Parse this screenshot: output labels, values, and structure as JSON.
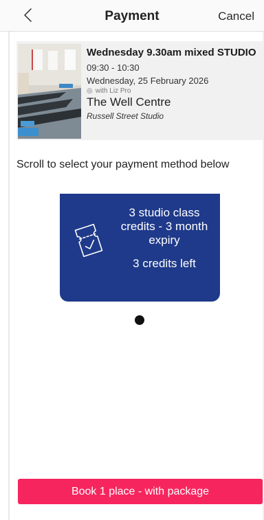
{
  "header": {
    "title": "Payment",
    "cancel_label": "Cancel",
    "back_icon": "chevron-left-icon"
  },
  "class": {
    "title": "Wednesday 9.30am mixed STUDIO",
    "time": "09:30 - 10:30",
    "date": "Wednesday, 25 February 2026",
    "instructor": "with Liz Pro",
    "venue": "The Well Centre",
    "room": "Russell Street Studio"
  },
  "instruction": "Scroll to select your payment method below",
  "payment_methods": [
    {
      "name": "3 studio class credits - 3 month expiry",
      "credits": "3 credits left",
      "icon": "ticket-check-icon"
    }
  ],
  "carousel": {
    "current": 1,
    "total": 1
  },
  "book_button_label": "Book 1 place - with package",
  "colors": {
    "card": "#1f3a8a",
    "button": "#f7255e"
  }
}
